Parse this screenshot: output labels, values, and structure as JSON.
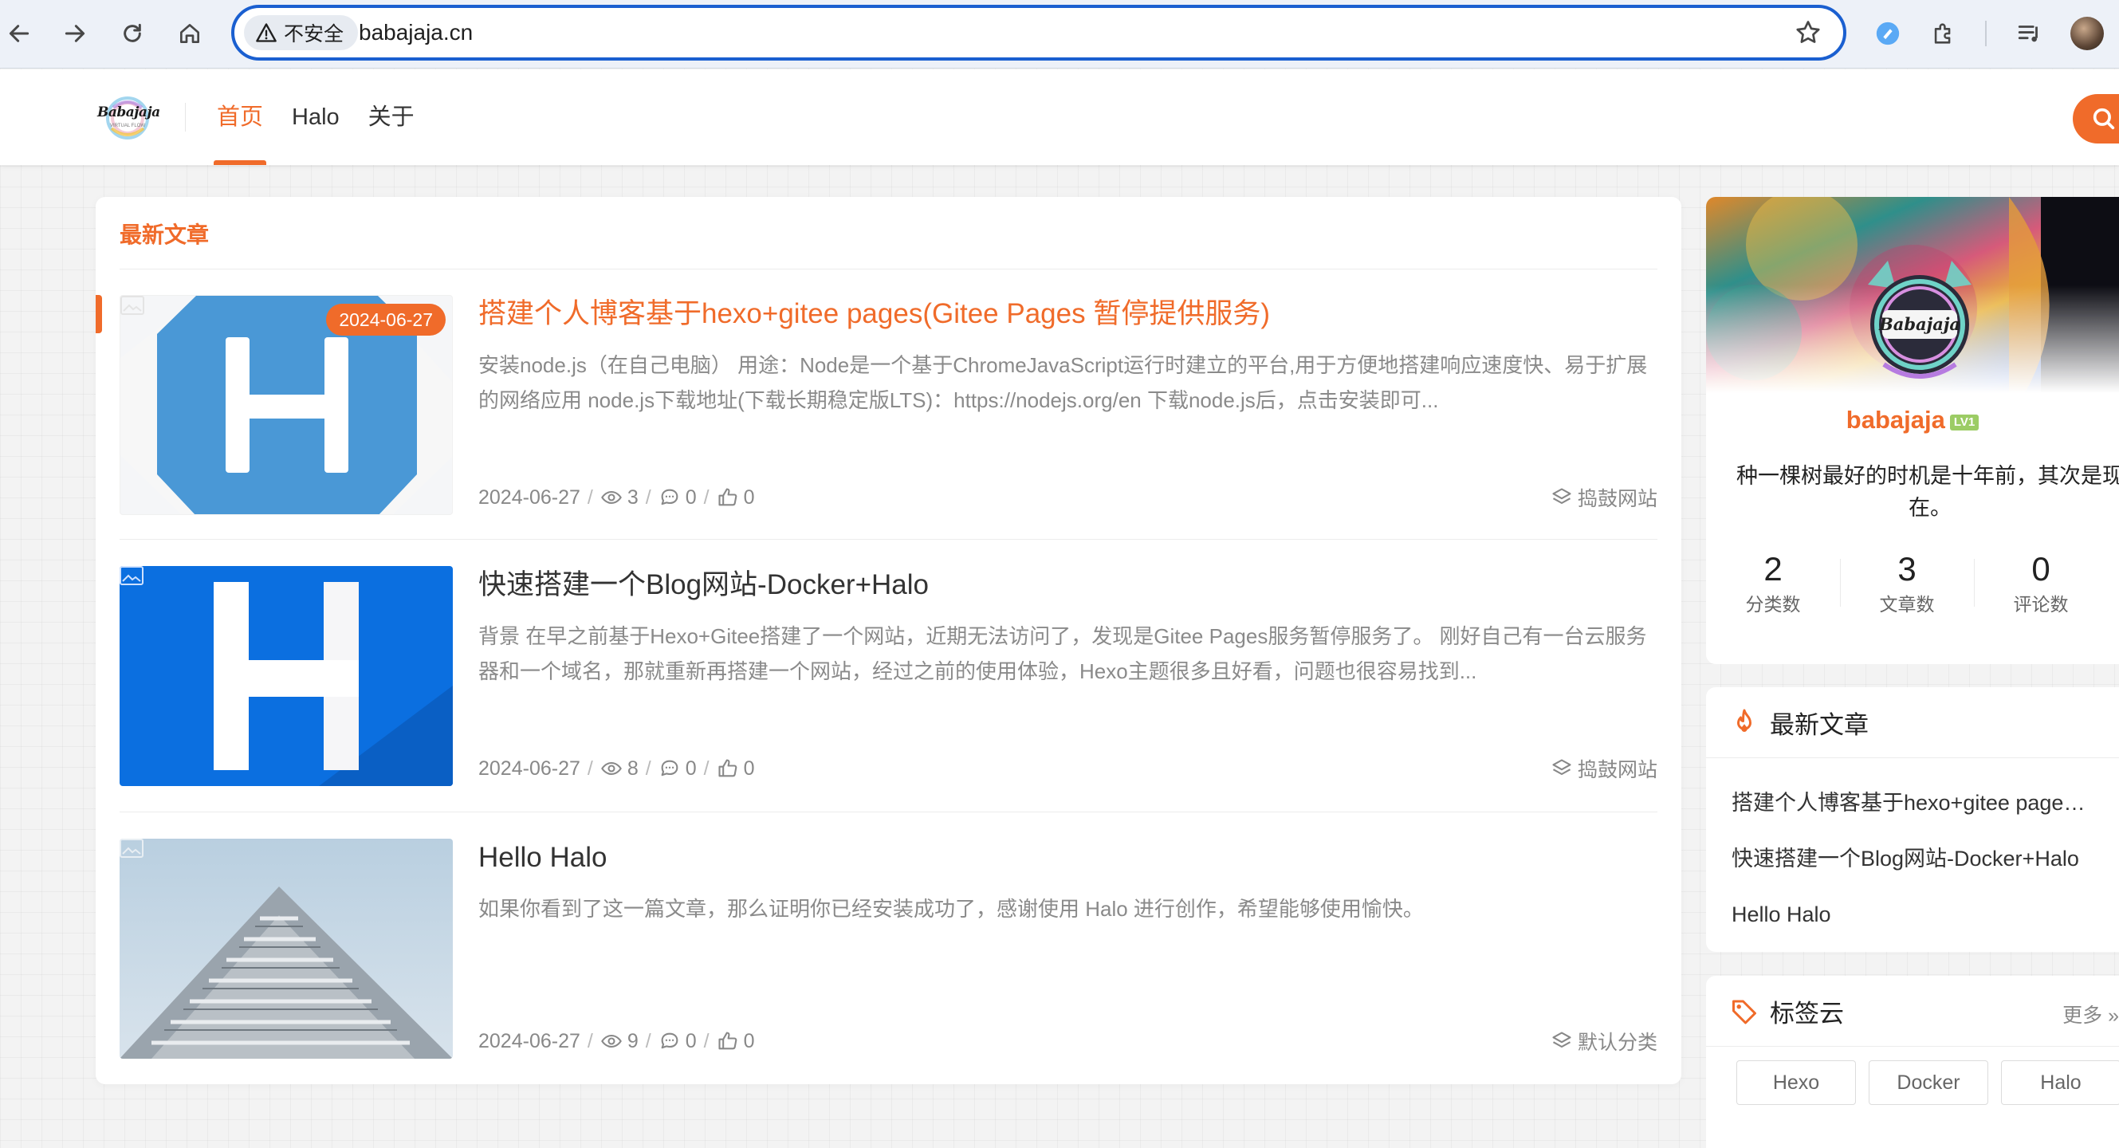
{
  "browser": {
    "security_label": "不安全",
    "url": "babajaja.cn"
  },
  "site": {
    "logo_text": "Babajaja",
    "logo_sub": "VIRTUAL FLOW",
    "nav": [
      {
        "label": "首页",
        "active": true
      },
      {
        "label": "Halo",
        "active": false
      },
      {
        "label": "关于",
        "active": false
      }
    ]
  },
  "main": {
    "section_title": "最新文章",
    "posts": [
      {
        "title": "搭建个人博客基于hexo+gitee pages(Gitee Pages 暂停提供服务)",
        "excerpt": "安装node.js（在自己电脑） 用途：Node是一个基于ChromeJavaScript运行时建立的平台,用于方便地搭建响应速度快、易于扩展的网络应用 node.js下载地址(下载长期稳定版LTS)：https://nodejs.org/en 下载node.js后，点击安装即可...",
        "date": "2024-06-27",
        "badge_date": "2024-06-27",
        "views": "3",
        "comments": "0",
        "likes": "0",
        "category": "捣鼓网站"
      },
      {
        "title": "快速搭建一个Blog网站-Docker+Halo",
        "excerpt": "背景 在早之前基于Hexo+Gitee搭建了一个网站，近期无法访问了，发现是Gitee Pages服务暂停服务了。 刚好自己有一台云服务器和一个域名，那就重新再搭建一个网站，经过之前的使用体验，Hexo主题很多且好看，问题也很容易找到...",
        "date": "2024-06-27",
        "views": "8",
        "comments": "0",
        "likes": "0",
        "category": "捣鼓网站"
      },
      {
        "title": "Hello Halo",
        "excerpt": "如果你看到了这一篇文章，那么证明你已经安装成功了，感谢使用 Halo 进行创作，希望能够使用愉快。",
        "date": "2024-06-27",
        "views": "9",
        "comments": "0",
        "likes": "0",
        "category": "默认分类"
      }
    ]
  },
  "sidebar": {
    "profile": {
      "name": "babajaja",
      "level": "LV1",
      "avatar_text": "Babajaja",
      "motto": "种一棵树最好的时机是十年前，其次是现在。",
      "stats": [
        {
          "value": "2",
          "label": "分类数"
        },
        {
          "value": "3",
          "label": "文章数"
        },
        {
          "value": "0",
          "label": "评论数"
        }
      ]
    },
    "recent": {
      "title": "最新文章",
      "items": [
        "搭建个人博客基于hexo+gitee pages(Gitee Pages 暂停提供服务)",
        "快速搭建一个Blog网站-Docker+Halo",
        "Hello Halo"
      ]
    },
    "tags": {
      "title": "标签云",
      "more_label": "更多 »",
      "items": [
        "Hexo",
        "Docker",
        "Halo"
      ]
    }
  },
  "colors": {
    "accent": "#f06b2a",
    "omnibox_border": "#1a5fd0"
  }
}
